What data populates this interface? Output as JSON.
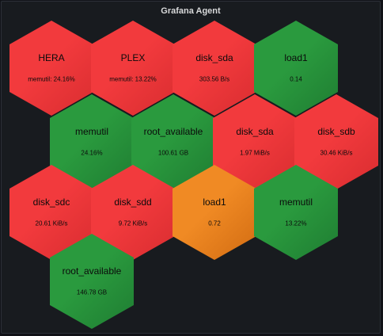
{
  "panel": {
    "title": "Grafana Agent"
  },
  "colors": {
    "red": "#f23a3d",
    "red_dark": "#d92d30",
    "green": "#2a9a3e",
    "green_dark": "#1f7d32",
    "orange": "#f08a24",
    "orange_dark": "#d26c12"
  },
  "hexagons": [
    {
      "name": "HERA",
      "value": "memutil: 24.16%",
      "status": "red"
    },
    {
      "name": "PLEX",
      "value": "memutil: 13.22%",
      "status": "red"
    },
    {
      "name": "disk_sda",
      "value": "303.56 B/s",
      "status": "red"
    },
    {
      "name": "load1",
      "value": "0.14",
      "status": "green"
    },
    {
      "name": "memutil",
      "value": "24.16%",
      "status": "green"
    },
    {
      "name": "root_available",
      "value": "100.61 GB",
      "status": "green"
    },
    {
      "name": "disk_sda",
      "value": "1.97 MiB/s",
      "status": "red"
    },
    {
      "name": "disk_sdb",
      "value": "30.46 KiB/s",
      "status": "red"
    },
    {
      "name": "disk_sdc",
      "value": "20.61 KiB/s",
      "status": "red"
    },
    {
      "name": "disk_sdd",
      "value": "9.72 KiB/s",
      "status": "red"
    },
    {
      "name": "load1",
      "value": "0.72",
      "status": "orange"
    },
    {
      "name": "memutil",
      "value": "13.22%",
      "status": "green"
    },
    {
      "name": "root_available",
      "value": "146.78 GB",
      "status": "green"
    }
  ]
}
